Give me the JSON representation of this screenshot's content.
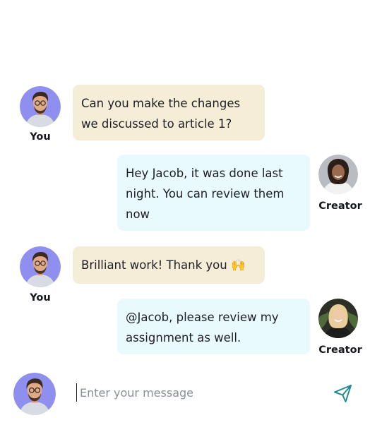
{
  "conversation": {
    "messages": [
      {
        "sender": "You",
        "text": "Can you make the changes\nwe discussed to article 1?"
      },
      {
        "sender": "Creator",
        "text": "Hey Jacob, it was done last\nnight. You can review them\nnow"
      },
      {
        "sender": "You",
        "text": "Brilliant work! Thank you 🙌"
      },
      {
        "sender": "Creator",
        "text": "@Jacob, please review my\nassignment as well."
      }
    ]
  },
  "composer": {
    "placeholder": "Enter your message",
    "send_icon": "send-icon"
  },
  "colors": {
    "my_bubble": "#f5edd8",
    "creator_bubble": "#e9fafe",
    "send_icon": "#1f8a93",
    "avatar_bg": "#8f8ff0"
  }
}
